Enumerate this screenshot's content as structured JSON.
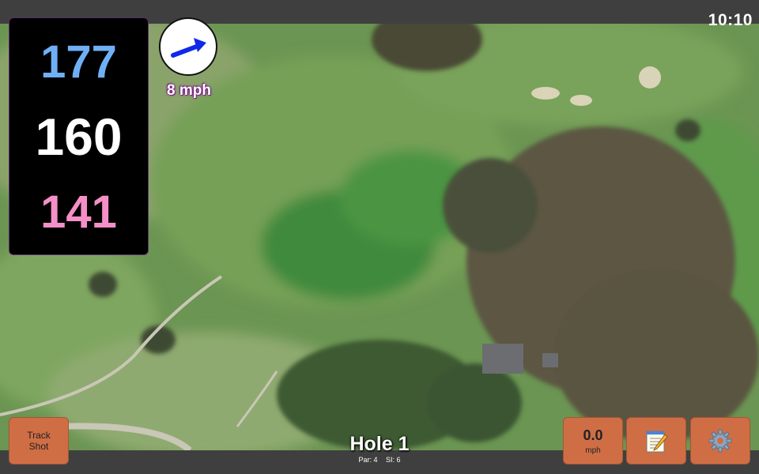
{
  "status_bar": {
    "time": "10:10"
  },
  "yardage": {
    "back": "177",
    "middle": "160",
    "front": "141"
  },
  "wind": {
    "speed_label": "8 mph",
    "icon": "wind-arrow-icon",
    "direction": "north-east"
  },
  "hole": {
    "title": "Hole 1",
    "par": "Par: 4",
    "si": "SI: 6"
  },
  "buttons": {
    "track_shot": "Track\nShot",
    "wind_value": "0.0",
    "wind_unit": "mph",
    "notes_icon": "notepad-icon",
    "settings_icon": "gear-icon"
  },
  "colors": {
    "button": "#cf6e45",
    "back": "#6fb0f5",
    "front": "#f58fc8",
    "bars": "#3f3f3f"
  }
}
